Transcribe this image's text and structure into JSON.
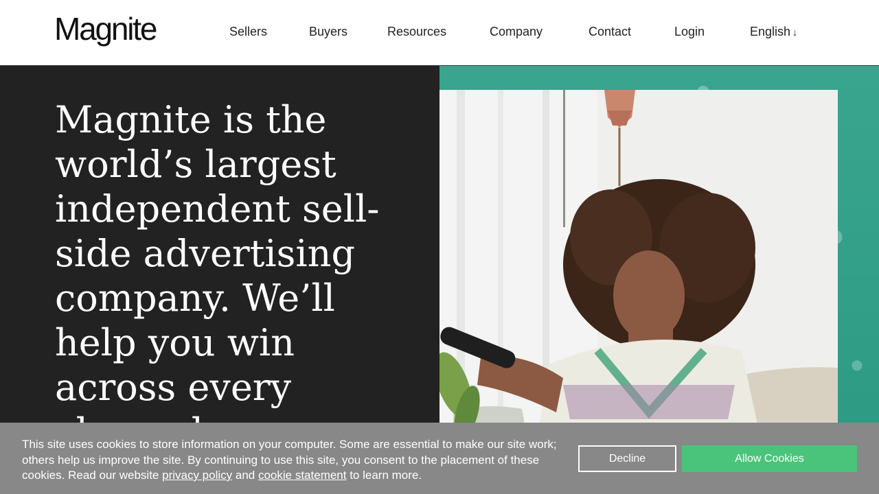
{
  "header": {
    "logo": "Magnite",
    "nav": {
      "sellers": "Sellers",
      "buyers": "Buyers",
      "resources": "Resources",
      "company": "Company",
      "contact": "Contact",
      "login": "Login",
      "language": "English",
      "language_icon": "arrow-down-icon"
    }
  },
  "hero": {
    "headline": "Magnite is the world’s largest independent sell-side advertising company. We’ll help you win across every channel.",
    "image": {
      "subject": "woman-watching-tv-photo",
      "accent_color": "#2e9e88"
    },
    "background_color": "#222222"
  },
  "cookie_banner": {
    "text_before": "This site uses cookies to store information on your computer. Some are essential to make our site work; others help us improve the site. By continuing to use this site, you consent to the placement of these cookies. Read our website ",
    "privacy_link": "privacy policy",
    "text_and": " and ",
    "cookie_link": "cookie statement",
    "text_after": " to learn more.",
    "decline_label": "Decline",
    "allow_label": "Allow Cookies",
    "allow_color": "#4bc47b",
    "background_color": "#888888"
  }
}
